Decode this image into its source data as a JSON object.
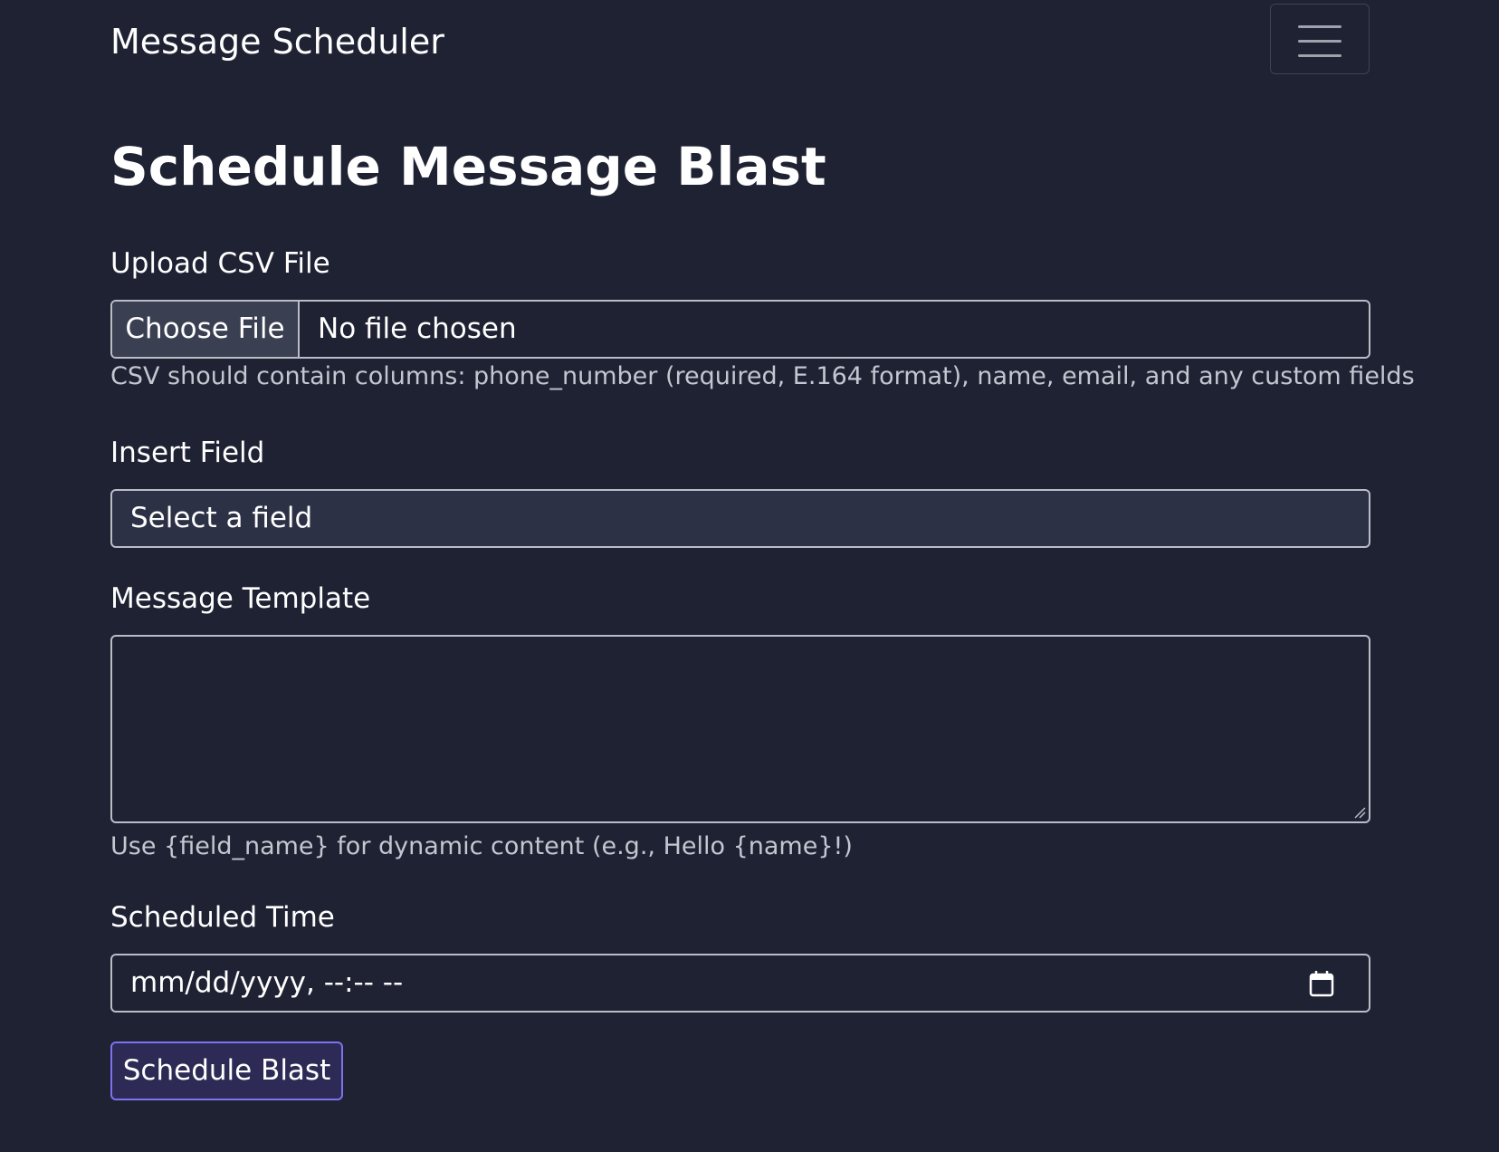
{
  "navbar": {
    "brand": "Message Scheduler",
    "menu_icon": "hamburger-menu-icon"
  },
  "page": {
    "title": "Schedule Message Blast"
  },
  "form": {
    "csv": {
      "label": "Upload CSV File",
      "button_label": "Choose File",
      "status": "No file chosen",
      "help": "CSV should contain columns: phone_number (required, E.164 format), name, email, and any custom fields"
    },
    "insert_field": {
      "label": "Insert Field",
      "selected": "Select a field"
    },
    "template": {
      "label": "Message Template",
      "value": "",
      "help": "Use {field_name} for dynamic content (e.g., Hello {name}!)"
    },
    "scheduled_time": {
      "label": "Scheduled Time",
      "placeholder": "mm/dd/yyyy, --:-- --",
      "icon": "calendar-icon"
    },
    "submit_label": "Schedule Blast"
  },
  "colors": {
    "background": "#1e2233",
    "input_border": "#b9bdc6",
    "select_background": "#2d3145",
    "button_border": "#7d72f0",
    "button_background": "#2d2b55",
    "help_text": "#c3c7d0"
  }
}
